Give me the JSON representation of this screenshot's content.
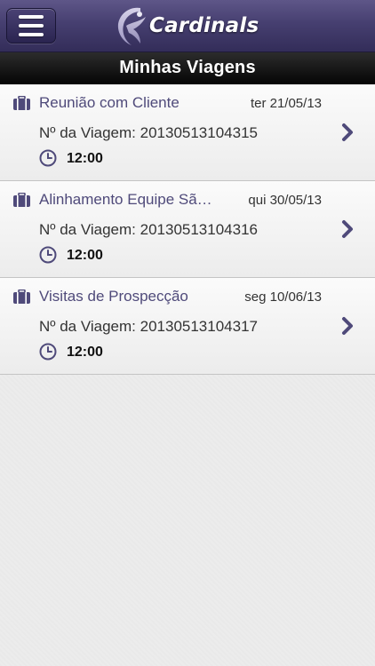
{
  "header": {
    "menu_icon": "hamburger-menu-icon",
    "brand_name": "Cardinals",
    "brand_color": "#463f70"
  },
  "page": {
    "title": "Minhas Viagens"
  },
  "trips": [
    {
      "title": "Reunião com Cliente",
      "date": "ter 21/05/13",
      "number": "Nº da Viagem: 20130513104315",
      "time": "12:00"
    },
    {
      "title": "Alinhamento Equipe Sã…",
      "date": "qui 30/05/13",
      "number": "Nº da Viagem: 20130513104316",
      "time": "12:00"
    },
    {
      "title": "Visitas de Prospecção",
      "date": "seg 10/06/13",
      "number": "Nº da Viagem: 20130513104317",
      "time": "12:00"
    }
  ],
  "colors": {
    "accent": "#4f4a7a",
    "title_bar": "#111111"
  }
}
